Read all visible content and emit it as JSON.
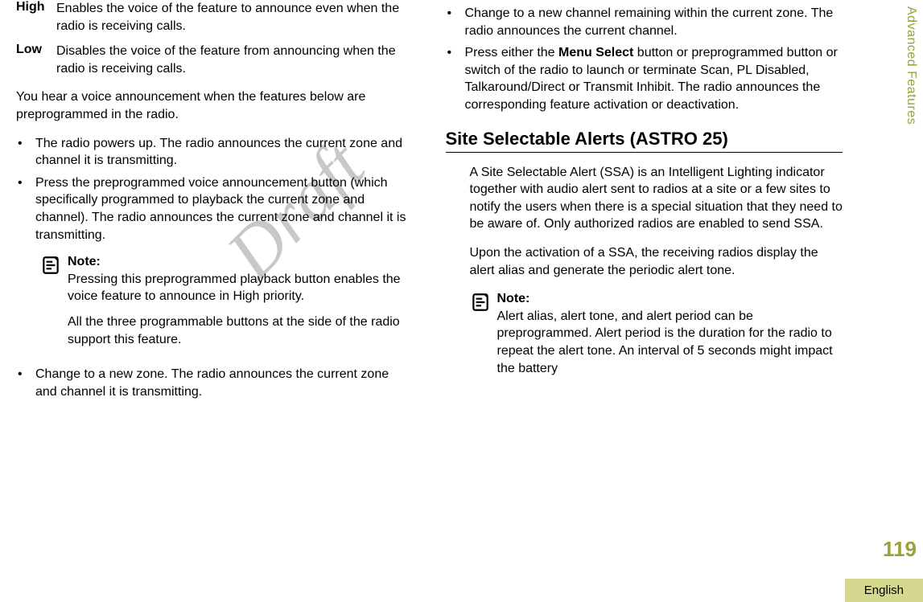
{
  "watermark": "Draft",
  "sideLabel": "Advanced Features",
  "pageNumber": "119",
  "language": "English",
  "left": {
    "defs": [
      {
        "term": "High",
        "desc": "Enables the voice of the feature to announce even when the radio is receiving calls."
      },
      {
        "term": "Low",
        "desc": "Disables the voice of the feature from announcing when the radio is receiving calls."
      }
    ],
    "intro": "You hear a voice announcement when the features below are preprogrammed in the radio.",
    "bullets": [
      "The radio powers up. The radio announces the current zone and channel it is transmitting.",
      "Press the preprogrammed voice announcement button (which specifically programmed to playback the current zone and channel). The radio announces the current zone and channel it is transmitting."
    ],
    "noteLabel": "Note:",
    "noteP1": "Pressing this preprogrammed playback button enables the voice feature to announce in High priority.",
    "noteP2": "All the three programmable buttons at the side of the radio support this feature.",
    "bullet3": "Change to a new zone. The radio announces the current zone and channel it is transmitting."
  },
  "right": {
    "bullets": [
      "Change to a new channel remaining within the current zone. The radio announces the current channel."
    ],
    "bullet2_pre": "Press either the ",
    "bullet2_bold": "Menu Select",
    "bullet2_post": " button or preprogrammed button or switch of the radio to launch or terminate Scan, PL Disabled, Talkaround/Direct or Transmit Inhibit. The radio announces the corresponding feature activation or deactivation.",
    "sectionTitle": "Site Selectable Alerts (ASTRO 25)",
    "p1": "A Site Selectable Alert (SSA) is an Intelligent Lighting indicator together with audio alert sent to radios at a site or a few sites to notify the users when there is a special situation that they need to be aware of. Only authorized radios are enabled to send SSA.",
    "p2": "Upon the activation of a SSA, the receiving radios display the alert alias and generate the periodic alert tone.",
    "noteLabel": "Note:",
    "noteP": "Alert alias, alert tone, and alert period can be preprogrammed. Alert period is the duration for the radio to repeat the alert tone. An interval of 5 seconds might impact the battery"
  }
}
